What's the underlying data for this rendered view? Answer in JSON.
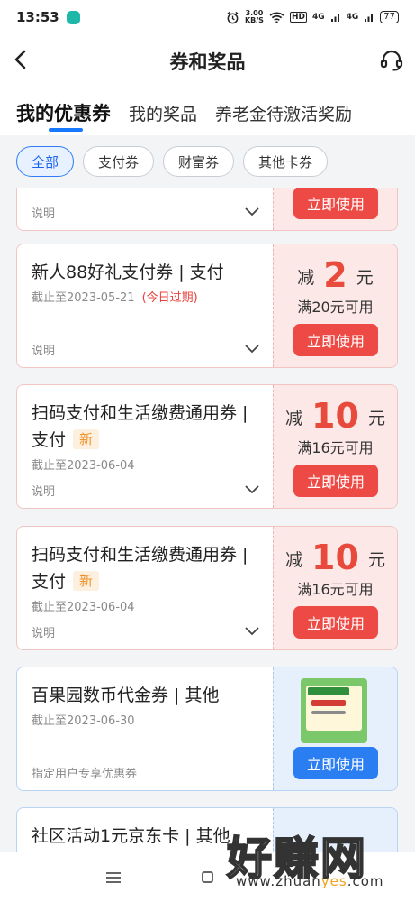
{
  "status_bar": {
    "time": "13:53",
    "net_speed_value": "3.00",
    "net_speed_unit": "KB/S",
    "hd_label": "HD",
    "signal1": "4G",
    "signal2": "4G",
    "battery": "77"
  },
  "header": {
    "title": "券和奖品"
  },
  "tabs": [
    {
      "label": "我的优惠券"
    },
    {
      "label": "我的奖品"
    },
    {
      "label": "养老金待激活奖励"
    }
  ],
  "filters": [
    {
      "label": "全部"
    },
    {
      "label": "支付券"
    },
    {
      "label": "财富券"
    },
    {
      "label": "其他卡券"
    }
  ],
  "partial_card": {
    "note": "说明",
    "button": "立即使用"
  },
  "coupons": [
    {
      "title": "新人88好礼支付券 | 支付",
      "date": "截止至2023-05-21",
      "expire": "(今日过期)",
      "prefix": "减",
      "amount": "2",
      "unit": "元",
      "condition": "满20元可用",
      "note": "说明",
      "button": "立即使用"
    },
    {
      "title": "扫码支付和生活缴费通用券 | 支付",
      "badge": "新",
      "date": "截止至2023-06-04",
      "prefix": "减",
      "amount": "10",
      "unit": "元",
      "condition": "满16元可用",
      "note": "说明",
      "button": "立即使用"
    },
    {
      "title": "扫码支付和生活缴费通用券 | 支付",
      "badge": "新",
      "date": "截止至2023-06-04",
      "prefix": "减",
      "amount": "10",
      "unit": "元",
      "condition": "满16元可用",
      "note": "说明",
      "button": "立即使用"
    },
    {
      "title": "百果园数币代金券 | 其他",
      "date": "截止至2023-06-30",
      "note": "指定用户专享优惠券",
      "button": "立即使用"
    },
    {
      "title": "社区活动1元京东卡 | 其他"
    }
  ],
  "watermark": {
    "text": "好赚网",
    "url_prefix": "www.zhuan",
    "url_mid": "yes",
    "url_suffix": ".com"
  },
  "colors": {
    "accent_blue": "#1677ff",
    "coupon_red": "#e84a3c",
    "button_red": "#ee4a45",
    "button_blue": "#2a7ef2"
  }
}
